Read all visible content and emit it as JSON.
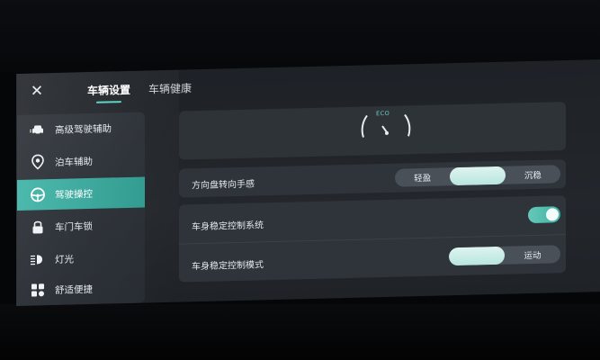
{
  "header": {
    "close_icon": "close-icon",
    "tabs": [
      {
        "label": "车辆设置",
        "active": true
      },
      {
        "label": "车辆健康",
        "active": false
      }
    ]
  },
  "sidebar": {
    "items": [
      {
        "label": "高级驾驶辅助",
        "icon": "car-assist-icon",
        "active": false
      },
      {
        "label": "泊车辅助",
        "icon": "parking-pin-icon",
        "active": false
      },
      {
        "label": "驾驶操控",
        "icon": "steering-wheel-icon",
        "active": true
      },
      {
        "label": "车门车锁",
        "icon": "lock-icon",
        "active": false
      },
      {
        "label": "灯光",
        "icon": "headlight-icon",
        "active": false
      },
      {
        "label": "舒适便捷",
        "icon": "grid-icon",
        "active": false
      }
    ]
  },
  "gauge": {
    "label": "ECO"
  },
  "steering": {
    "label": "方向盘转向手感",
    "options": [
      "轻盈",
      "",
      "沉稳"
    ],
    "selected_index": 1
  },
  "esc": {
    "system_label": "车身稳定控制系统",
    "system_enabled": true,
    "mode_label": "车身稳定控制模式",
    "mode_options": [
      "",
      "运动"
    ],
    "mode_selected_index": 0
  },
  "colors": {
    "accent": "#3fb3a6",
    "selected_segment": "#dff3f0",
    "card": "#2f343a"
  }
}
